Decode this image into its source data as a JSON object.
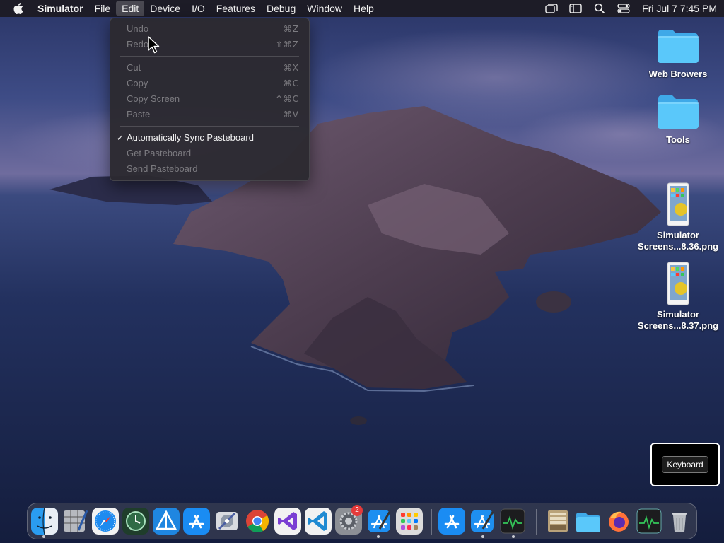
{
  "menubar": {
    "apple_icon": "apple-logo-icon",
    "app_name": "Simulator",
    "menus": [
      "File",
      "Edit",
      "Device",
      "I/O",
      "Features",
      "Debug",
      "Window",
      "Help"
    ],
    "active_menu": "Edit",
    "status_icons": [
      "window-stack-icon",
      "sidebar-icon",
      "search-icon",
      "control-center-icon"
    ],
    "clock": "Fri Jul 7  7:45 PM"
  },
  "edit_menu": {
    "groups": [
      [
        {
          "label": "Undo",
          "shortcut": "⌘Z",
          "enabled": false
        },
        {
          "label": "Redo",
          "shortcut": "⇧⌘Z",
          "enabled": false
        }
      ],
      [
        {
          "label": "Cut",
          "shortcut": "⌘X",
          "enabled": false
        },
        {
          "label": "Copy",
          "shortcut": "⌘C",
          "enabled": false
        },
        {
          "label": "Copy Screen",
          "shortcut": "^⌘C",
          "enabled": false
        },
        {
          "label": "Paste",
          "shortcut": "⌘V",
          "enabled": false
        }
      ],
      [
        {
          "label": "Automatically Sync Pasteboard",
          "shortcut": "",
          "enabled": true,
          "checked": true
        },
        {
          "label": "Get Pasteboard",
          "shortcut": "",
          "enabled": false
        },
        {
          "label": "Send Pasteboard",
          "shortcut": "",
          "enabled": false
        }
      ]
    ]
  },
  "desktop": {
    "icons": [
      {
        "label": "Web Browers",
        "kind": "folder-icon"
      },
      {
        "label": "Tools",
        "kind": "folder-icon"
      },
      {
        "label": "Simulator Screens...8.36.png",
        "line1": "Simulator",
        "line2": "Screens...8.36.png",
        "kind": "screenshot-file-icon"
      },
      {
        "label": "Simulator Screens...8.37.png",
        "line1": "Simulator",
        "line2": "Screens...8.37.png",
        "kind": "screenshot-file-icon"
      }
    ]
  },
  "keyboard_panel": {
    "label": "Keyboard"
  },
  "dock": {
    "items": [
      {
        "name": "finder-icon",
        "running": true
      },
      {
        "name": "script-editor-icon",
        "running": false
      },
      {
        "name": "safari-icon",
        "running": false
      },
      {
        "name": "time-machine-icon",
        "running": false
      },
      {
        "name": "xcode-instruments-icon",
        "running": false
      },
      {
        "name": "app-store-icon",
        "running": false
      },
      {
        "name": "disk-utility-icon",
        "running": false
      },
      {
        "name": "chrome-icon",
        "running": false
      },
      {
        "name": "visual-studio-icon",
        "running": false
      },
      {
        "name": "vscode-icon",
        "running": false
      },
      {
        "name": "system-settings-icon",
        "running": false,
        "badge": "2"
      },
      {
        "name": "xcode-icon",
        "running": true
      },
      {
        "name": "launchpad-icon",
        "running": false
      },
      {
        "name": "app-store-recent-icon",
        "running": false
      },
      {
        "name": "xcode-recent-icon",
        "running": true
      },
      {
        "name": "activity-monitor-recent-icon",
        "running": true
      },
      {
        "name": "archive-icon",
        "running": false
      },
      {
        "name": "downloads-folder-icon",
        "running": false
      },
      {
        "name": "firefox-icon",
        "running": false
      },
      {
        "name": "activity-monitor-icon",
        "running": false
      },
      {
        "name": "trash-icon",
        "running": false
      }
    ]
  },
  "colors": {
    "menubar_bg": "#1c1a22",
    "menu_bg": "#2c2a30",
    "folder_blue": "#5ac8fa",
    "badge_red": "#e53a3a"
  }
}
